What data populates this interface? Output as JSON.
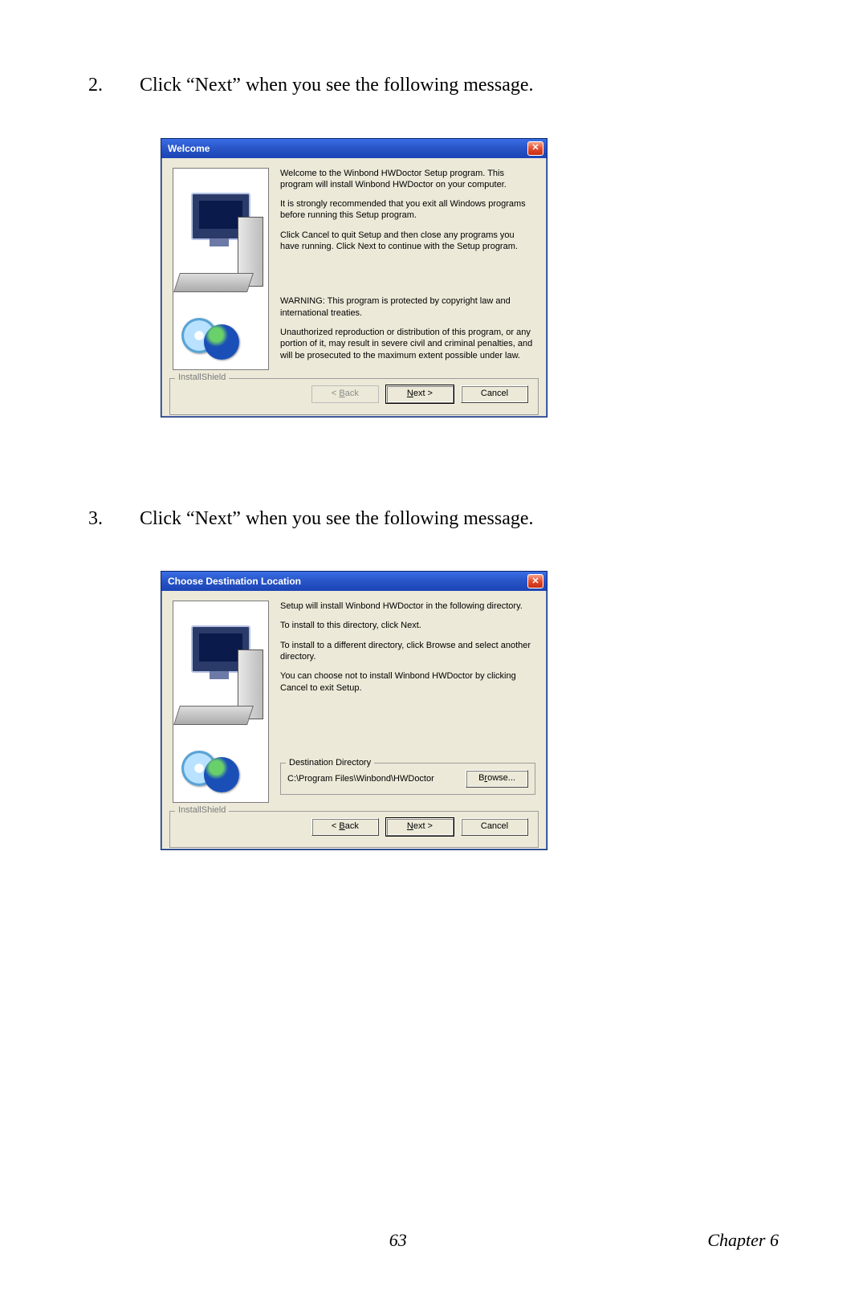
{
  "steps": {
    "s2": {
      "num": "2.",
      "text": "Click “Next” when you see the following message."
    },
    "s3": {
      "num": "3.",
      "text": "Click “Next” when you see the following message."
    }
  },
  "dialog1": {
    "title": "Welcome",
    "close_glyph": "✕",
    "p1": "Welcome to the Winbond HWDoctor Setup program.  This program will install Winbond HWDoctor on your computer.",
    "p2": "It is strongly recommended that you exit all Windows programs before running this Setup program.",
    "p3": "Click Cancel to quit Setup and then close any programs you have running.  Click Next to continue with the Setup program.",
    "p4": "WARNING: This program is protected by copyright law and international treaties.",
    "p5": "Unauthorized reproduction or distribution of this program, or any portion of it, may result in severe civil and criminal penalties, and will be prosecuted to the maximum extent possible under law.",
    "group_label": "InstallShield",
    "back_label": "< Back",
    "next_label": "Next >",
    "cancel_label": "Cancel"
  },
  "dialog2": {
    "title": "Choose Destination Location",
    "close_glyph": "✕",
    "p1": "Setup will install Winbond HWDoctor in the following directory.",
    "p2": "To install to this directory, click Next.",
    "p3": "To install to a different directory, click Browse and select another directory.",
    "p4": "You can choose not to install Winbond HWDoctor by clicking Cancel to exit Setup.",
    "dest_legend": "Destination Directory",
    "dest_path": "C:\\Program Files\\Winbond\\HWDoctor",
    "browse_label": "Browse...",
    "group_label": "InstallShield",
    "back_label": "< Back",
    "next_label": "Next >",
    "cancel_label": "Cancel"
  },
  "footer": {
    "page_num": "63",
    "chapter": "Chapter 6"
  }
}
